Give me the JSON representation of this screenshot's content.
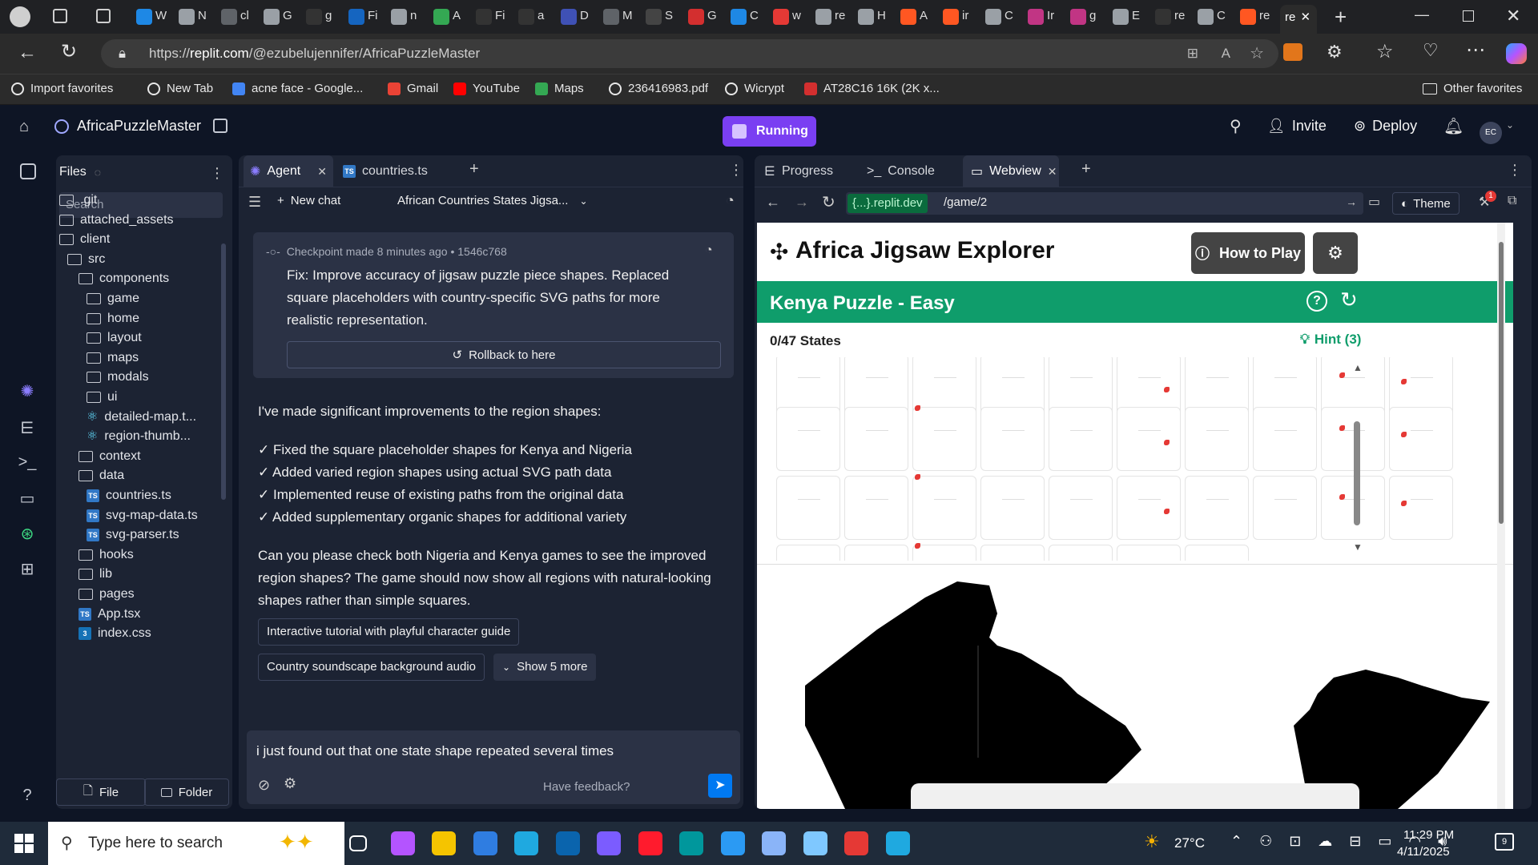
{
  "browser": {
    "url_host": "replit.com",
    "url_path": "/@ezubelujennifer/AfricaPuzzleMaster",
    "url_scheme": "https://",
    "favorites": [
      {
        "label": "Import favorites",
        "icon": "import-icon",
        "color": "#e8e8e8"
      },
      {
        "label": "New Tab",
        "icon": "globe-icon",
        "color": "#e8e8e8"
      },
      {
        "label": "acne face - Google...",
        "icon": "google-icon",
        "color": "#4285f4"
      },
      {
        "label": "Gmail",
        "icon": "gmail-icon",
        "color": "#ea4335"
      },
      {
        "label": "YouTube",
        "icon": "youtube-icon",
        "color": "#ff0000"
      },
      {
        "label": "Maps",
        "icon": "maps-icon",
        "color": "#34a853"
      },
      {
        "label": "236416983.pdf",
        "icon": "globe-icon",
        "color": "#e8e8e8"
      },
      {
        "label": "Wicrypt",
        "icon": "wicrypt-icon",
        "color": "#e8e8e8"
      },
      {
        "label": "AT28C16 16K (2K x...",
        "icon": "chip-icon",
        "color": "#d32f2f"
      }
    ],
    "other_favorites": "Other favorites",
    "tabs_text": [
      "W",
      "N",
      "cl",
      "G",
      "g",
      "Fi",
      "n",
      "A",
      "Fi",
      "a",
      "D",
      "M",
      "S",
      "G",
      "C",
      "w",
      "re",
      "H",
      "A",
      "ir",
      "C",
      "Ir",
      "g",
      "E",
      "re",
      "C",
      "re"
    ]
  },
  "replit": {
    "project_name": "AfricaPuzzleMaster",
    "status": "Running",
    "invite": "Invite",
    "deploy": "Deploy",
    "avatar": "EC"
  },
  "files": {
    "title": "Files",
    "search_placeholder": "Search",
    "items": [
      {
        "label": ".git",
        "type": "folder",
        "depth": 0
      },
      {
        "label": "attached_assets",
        "type": "folder",
        "depth": 0
      },
      {
        "label": "client",
        "type": "folder-open",
        "depth": 0
      },
      {
        "label": "src",
        "type": "folder-open",
        "depth": 1
      },
      {
        "label": "components",
        "type": "folder-open",
        "depth": 2
      },
      {
        "label": "game",
        "type": "folder",
        "depth": 3
      },
      {
        "label": "home",
        "type": "folder",
        "depth": 3
      },
      {
        "label": "layout",
        "type": "folder",
        "depth": 3
      },
      {
        "label": "maps",
        "type": "folder",
        "depth": 3
      },
      {
        "label": "modals",
        "type": "folder",
        "depth": 3
      },
      {
        "label": "ui",
        "type": "folder",
        "depth": 3
      },
      {
        "label": "detailed-map.t...",
        "type": "react",
        "depth": 3
      },
      {
        "label": "region-thumb...",
        "type": "react",
        "depth": 3
      },
      {
        "label": "context",
        "type": "folder",
        "depth": 2
      },
      {
        "label": "data",
        "type": "folder-open",
        "depth": 2
      },
      {
        "label": "countries.ts",
        "type": "ts",
        "depth": 3
      },
      {
        "label": "svg-map-data.ts",
        "type": "ts",
        "depth": 3
      },
      {
        "label": "svg-parser.ts",
        "type": "ts",
        "depth": 3
      },
      {
        "label": "hooks",
        "type": "folder",
        "depth": 2
      },
      {
        "label": "lib",
        "type": "folder",
        "depth": 2
      },
      {
        "label": "pages",
        "type": "folder",
        "depth": 2
      },
      {
        "label": "App.tsx",
        "type": "tsx",
        "depth": 2
      },
      {
        "label": "index.css",
        "type": "css",
        "depth": 2
      }
    ],
    "new_file": "File",
    "new_folder": "Folder"
  },
  "agent": {
    "tab_agent": "Agent",
    "tab_file": "countries.ts",
    "new_chat": "New chat",
    "chat_title": "African Countries States Jigsa...",
    "checkpoint": "Checkpoint made 8 minutes ago • 1546c768",
    "checkpoint_desc": "Fix: Improve accuracy of jigsaw puzzle piece shapes. Replaced square placeholders with country-specific SVG paths for more realistic representation.",
    "rollback": "Rollback to here",
    "msg_intro": "I've made significant improvements to the region shapes:",
    "msg_points": [
      "✓ Fixed the square placeholder shapes for Kenya and Nigeria",
      "✓ Added varied region shapes using actual SVG path data",
      "✓ Implemented reuse of existing paths from the original data",
      "✓ Added supplementary organic shapes for additional variety"
    ],
    "msg_question": "Can you please check both Nigeria and Kenya games to see the improved region shapes? The game should now show all regions with natural-looking shapes rather than simple squares.",
    "suggestion1": "Interactive tutorial with playful character guide",
    "suggestion2": "Country soundscape background audio",
    "show_more": "Show 5 more",
    "input_value": "i just found out that one  state shape repeated several times",
    "feedback": "Have feedback?"
  },
  "webview": {
    "tab_progress": "Progress",
    "tab_console": "Console",
    "tab_webview": "Webview",
    "domain": "{...}.replit.dev",
    "path": "/game/2",
    "theme": "Theme",
    "badge": "1"
  },
  "game": {
    "title": "Africa Jigsaw Explorer",
    "how_to_play": "How to Play",
    "puzzle_title": "Kenya Puzzle - Easy",
    "progress": "0/47 States",
    "hint": "Hint (3)",
    "accent": "#0f9d6b"
  },
  "taskbar": {
    "search_placeholder": "Type here to search",
    "weather": "27°C",
    "time": "11:29 PM",
    "date": "4/11/2025",
    "notifications": "9"
  }
}
